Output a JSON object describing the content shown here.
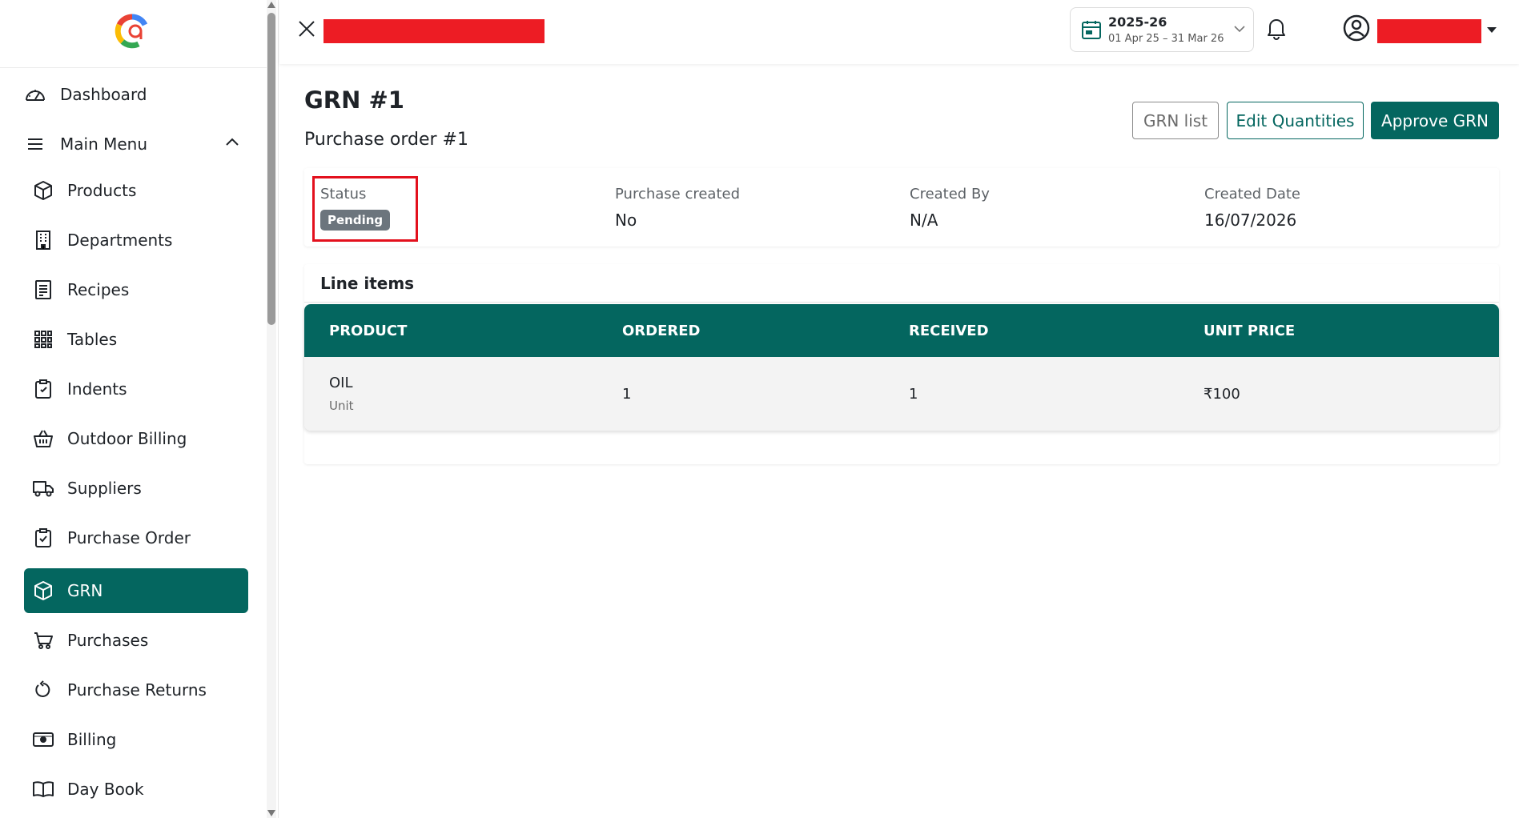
{
  "sidebar": {
    "top_items": [
      {
        "label": "Dashboard",
        "icon": "gauge-icon"
      },
      {
        "label": "Main Menu",
        "icon": "menu-icon"
      }
    ],
    "items": [
      {
        "label": "Products",
        "icon": "box-icon"
      },
      {
        "label": "Departments",
        "icon": "building-icon"
      },
      {
        "label": "Recipes",
        "icon": "receipt-icon"
      },
      {
        "label": "Tables",
        "icon": "grid-icon"
      },
      {
        "label": "Indents",
        "icon": "clipboard-icon"
      },
      {
        "label": "Outdoor Billing",
        "icon": "basket-icon"
      },
      {
        "label": "Suppliers",
        "icon": "truck-icon"
      },
      {
        "label": "Purchase Order",
        "icon": "clipboard-check-icon"
      },
      {
        "label": "GRN",
        "icon": "box-icon",
        "active": true
      },
      {
        "label": "Purchases",
        "icon": "cart-icon"
      },
      {
        "label": "Purchase Returns",
        "icon": "rotate-icon"
      },
      {
        "label": "Billing",
        "icon": "cash-icon"
      },
      {
        "label": "Day Book",
        "icon": "book-icon"
      }
    ]
  },
  "topbar": {
    "fiscal_year": "2025-26",
    "fiscal_range": "01 Apr 25 – 31 Mar 26"
  },
  "page": {
    "title": "GRN #1",
    "subtitle": "Purchase order #1"
  },
  "actions": {
    "grn_list": "GRN list",
    "edit_quantities": "Edit Quantities",
    "approve_grn": "Approve GRN"
  },
  "info": {
    "status_label": "Status",
    "status_value": "Pending",
    "purchase_created_label": "Purchase created",
    "purchase_created_value": "No",
    "created_by_label": "Created By",
    "created_by_value": "N/A",
    "created_date_label": "Created Date",
    "created_date_value": "16/07/2026"
  },
  "line_items": {
    "title": "Line items",
    "headers": {
      "product": "PRODUCT",
      "ordered": "ORDERED",
      "received": "RECEIVED",
      "unit_price": "UNIT PRICE"
    },
    "rows": [
      {
        "product": "OIL",
        "unit": "Unit",
        "ordered": "1",
        "received": "1",
        "unit_price": "₹100"
      }
    ]
  },
  "colors": {
    "primary": "#04665f",
    "badge_grey": "#6c757d",
    "highlight_red": "#e3101d",
    "redaction_red": "#ed1c24"
  }
}
